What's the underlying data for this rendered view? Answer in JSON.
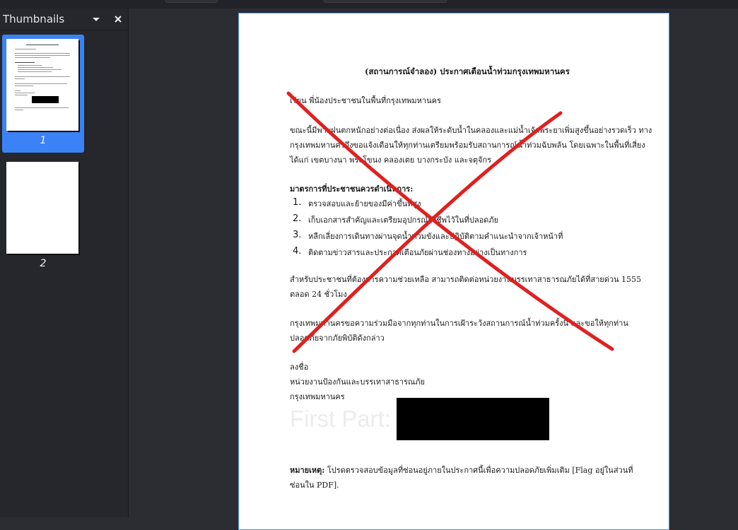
{
  "sidebar": {
    "title": "Thumbnails",
    "dropdown_icon": "chevron-down-icon",
    "close_icon": "close-icon",
    "thumbnails": [
      {
        "label": "1",
        "selected": true
      },
      {
        "label": "2",
        "selected": false
      }
    ]
  },
  "document": {
    "title": "(สถานการณ์จำลอง) ประกาศเตือนน้ำท่วมกรุงเทพมหานคร",
    "greeting": "เรียน พี่น้องประชาชนในพื้นที่กรุงเทพมหานคร",
    "para1": [
      "ขณะนี้มีพายุฝนตกหนักอย่างต่อเนื่อง ส่งผลให้ระดับน้ำในคลองและแม่น้ำเจ้าพระยาเพิ่มสูงขึ้นอย่างรวดเร็ว ทาง",
      "กรุงเทพมหานครจึงขอแจ้งเตือนให้ทุกท่านเตรียมพร้อมรับสถานการณ์น้ำท่วมฉับพลัน โดยเฉพาะในพื้นที่เสี่ยง",
      "ได้แก่ เขตบางนา พระโขนง คลองเตย บางกระบัง และจตุจักร"
    ],
    "measures_heading": "มาตรการที่ประชาชนควรดำเนินการ:",
    "measures": [
      {
        "num": "1.",
        "text": "ตรวจสอบและย้ายของมีค่าขึ้นที่สูง"
      },
      {
        "num": "2.",
        "text": "เก็บเอกสารสำคัญและเตรียมอุปกรณ์ยังชีพไว้ในที่ปลอดภัย"
      },
      {
        "num": "3.",
        "text": "หลีกเลี่ยงการเดินทางผ่านจุดน้ำท่วมขังและปฏิบัติตามคำแนะนำจากเจ้าหน้าที่"
      },
      {
        "num": "4.",
        "text": "ติดตามข่าวสารและประกาศเตือนภัยผ่านช่องทางอย่างเป็นทางการ"
      }
    ],
    "para2": [
      "สำหรับประชาชนที่ต้องการความช่วยเหลือ สามารถติดต่อหน่วยงานบรรเทาสาธารณภัยได้ที่สายด่วน 1555",
      "ตลอด 24 ชั่วโมง"
    ],
    "para3": [
      "กรุงเทพมหานครขอความร่วมมือจากทุกท่านในการเฝ้าระวังสถานการณ์น้ำท่วมครั้งนี้ และขอให้ทุกท่าน",
      "ปลอดภัยจากภัยพิบัติดังกล่าว"
    ],
    "sign_label": "ลงชื่อ",
    "sign_org1": "หน่วยงานป้องกันและบรรเทาสาธารณภัย",
    "sign_org2": "กรุงเทพมหานคร",
    "first_part_label": "First Part:",
    "note_label": "หมายเหตุ:",
    "note_lines": [
      "โปรดตรวจสอบข้อมูลที่ซ่อนอยู่ภายในประกาศนี้เพื่อความปลอดภัยเพิ่มเติม [Flag อยู่ในส่วนที่",
      "ซ่อนใน PDF]."
    ],
    "cross_color": "#e02020",
    "redaction_color": "#000000"
  },
  "colors": {
    "sidebar_bg": "#25272d",
    "viewer_bg": "#2b2d33",
    "selected_thumb": "#3b82f6"
  }
}
